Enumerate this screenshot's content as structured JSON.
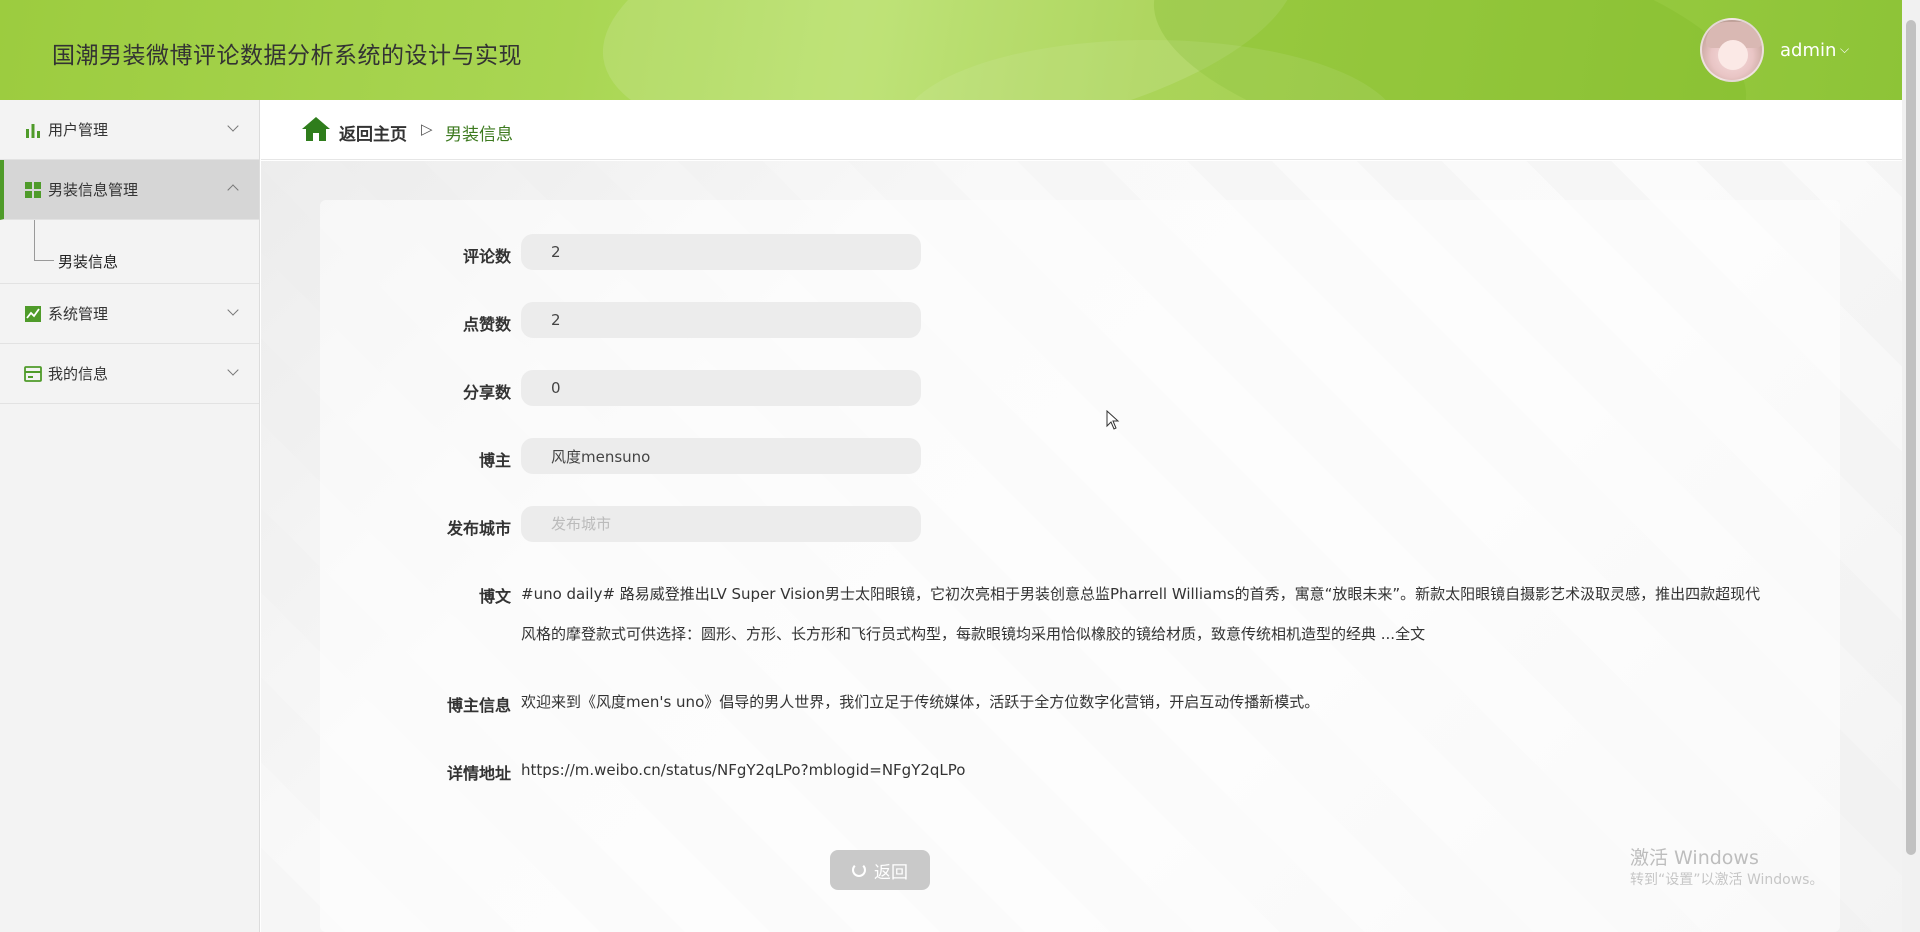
{
  "header": {
    "title": "国潮男装微博评论数据分析系统的设计与实现",
    "user_name": "admin"
  },
  "sidebar": {
    "items": [
      {
        "label": "用户管理",
        "icon": "bar-chart-icon"
      },
      {
        "label": "男装信息管理",
        "icon": "grid-icon"
      },
      {
        "label": "系统管理",
        "icon": "line-chart-icon"
      },
      {
        "label": "我的信息",
        "icon": "card-icon"
      }
    ],
    "submenu_label": "男装信息"
  },
  "breadcrumb": {
    "home": "返回主页",
    "separator": "▷",
    "current": "男装信息"
  },
  "form": {
    "comments_label": "评论数",
    "comments_value": "2",
    "likes_label": "点赞数",
    "likes_value": "2",
    "shares_label": "分享数",
    "shares_value": "0",
    "blogger_label": "博主",
    "blogger_value": "风度mensuno",
    "city_label": "发布城市",
    "city_placeholder": "发布城市",
    "post_label": "博文",
    "post_line1": "#uno daily# 路易威登推出LV Super Vision男士太阳眼镜，它初次亮相于男装创意总监Pharrell Williams的首秀，寓意“放眼未来”。新款太阳眼镜自摄影艺术汲取灵感，推出四款超现代",
    "post_line2": "风格的摩登款式可供选择：圆形、方形、长方形和飞行员式构型，每款眼镜均采用恰似橡胶的镜给材质，致意传统相机造型的经典 ...全文",
    "blogger_info_label": "博主信息",
    "blogger_info_value": "欢迎来到《风度men's uno》倡导的男人世界，我们立足于传统媒体，活跃于全方位数字化营销，开启互动传播新模式。",
    "url_label": "详情地址",
    "url_value": "https://m.weibo.cn/status/NFgY2qLPo?mblogid=NFgY2qLPo"
  },
  "buttons": {
    "back": "返回"
  },
  "watermark": {
    "line1": "激活 Windows",
    "line2": "转到“设置”以激活 Windows。"
  },
  "colors": {
    "accent": "#4f9b2a",
    "header_green": "#a9d653"
  }
}
